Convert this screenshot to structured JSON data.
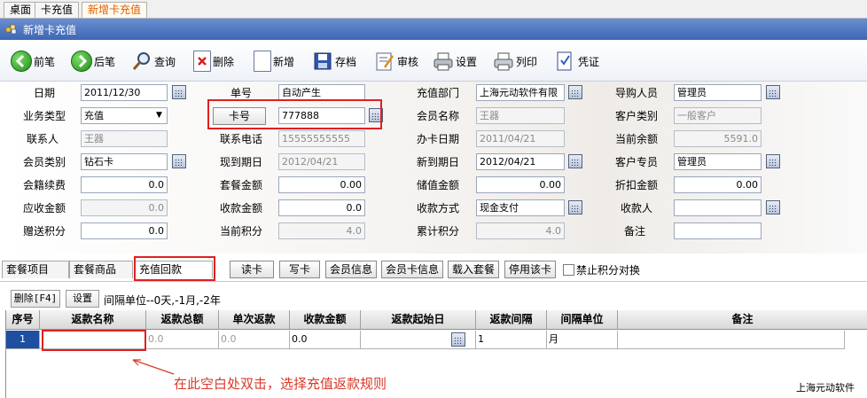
{
  "tabs": {
    "desktop": "桌面",
    "recharge": "卡充值",
    "new_recharge": "新增卡充值"
  },
  "window": {
    "title": "新增卡充值"
  },
  "toolbar": {
    "prev": "前笔",
    "next": "后笔",
    "query": "查询",
    "delete": "删除",
    "add": "新增",
    "save": "存档",
    "audit": "审核",
    "settings": "设置",
    "print": "列印",
    "voucher": "凭证"
  },
  "form": {
    "date_label": "日期",
    "date_value": "2011/12/30",
    "bill_no_label": "单号",
    "bill_no_value": "自动产生",
    "dept_label": "充值部门",
    "dept_value": "上海元动软件有限",
    "guide_label": "导购人员",
    "guide_value": "管理员",
    "biz_type_label": "业务类型",
    "biz_type_value": "充值",
    "card_no_button": "卡号",
    "card_no_value": "777888",
    "member_name_label": "会员名称",
    "member_name_value": "王器",
    "cust_type_label": "客户类别",
    "cust_type_value": "一般客户",
    "contact_label": "联系人",
    "contact_value": "王器",
    "phone_label": "联系电话",
    "phone_value": "15555555555",
    "card_date_label": "办卡日期",
    "card_date_value": "2011/04/21",
    "balance_label": "当前余额",
    "balance_value": "5591.0",
    "member_class_label": "会员类别",
    "member_class_value": "钻石卡",
    "current_expire_label": "现到期日",
    "current_expire_value": "2012/04/21",
    "new_expire_label": "新到期日",
    "new_expire_value": "2012/04/21",
    "cust_rep_label": "客户专员",
    "cust_rep_value": "管理员",
    "renew_fee_label": "会籍续费",
    "renew_fee_value": "0.0",
    "package_amt_label": "套餐金额",
    "package_amt_value": "0.00",
    "stored_amt_label": "储值金额",
    "stored_amt_value": "0.00",
    "discount_amt_label": "折扣金额",
    "discount_amt_value": "0.00",
    "receivable_label": "应收金额",
    "receivable_value": "0.0",
    "received_label": "收款金额",
    "received_value": "0.0",
    "pay_method_label": "收款方式",
    "pay_method_value": "现金支付",
    "payee_label": "收款人",
    "payee_value": "",
    "gift_points_label": "赠送积分",
    "gift_points_value": "0.0",
    "current_points_label": "当前积分",
    "current_points_value": "4.0",
    "total_points_label": "累计积分",
    "total_points_value": "4.0",
    "remark_label": "备注",
    "remark_value": ""
  },
  "subtabs": {
    "package_items": "套餐项目",
    "package_goods": "套餐商品",
    "recharge_refund": "充值回款"
  },
  "actions": {
    "read_card": "读卡",
    "write_card": "写卡",
    "member_info": "会员信息",
    "member_card_info": "会员卡信息",
    "load_package": "载入套餐",
    "disable_card": "停用该卡",
    "no_points_exchange": "禁止积分对换"
  },
  "gridbar": {
    "delete_f4": "删除[F4]",
    "settings": "设置",
    "interval_hint": "间隔单位--0天,-1月,-2年"
  },
  "grid": {
    "headers": [
      "序号",
      "返款名称",
      "返款总额",
      "单次返款",
      "收款金额",
      "返款起始日",
      "返款间隔",
      "间隔单位",
      "备注"
    ],
    "row": [
      "1",
      "",
      "0.0",
      "0.0",
      "0.0",
      "",
      "1",
      "月",
      ""
    ]
  },
  "annotation": "在此空白处双击，选择充值返款规则",
  "brand": "上海元动软件",
  "colors": {
    "highlight_red": "#e02020",
    "annotation_red": "#d83a2a",
    "title_blue": "#3d66b4",
    "row_selected": "#1f4fa0"
  },
  "icons": [
    "back-arrow-icon",
    "forward-arrow-icon",
    "magnifier-icon",
    "delete-doc-icon",
    "new-doc-icon",
    "save-icon",
    "audit-icon",
    "printer-settings-icon",
    "printer-icon",
    "voucher-icon",
    "calendar-icon"
  ]
}
